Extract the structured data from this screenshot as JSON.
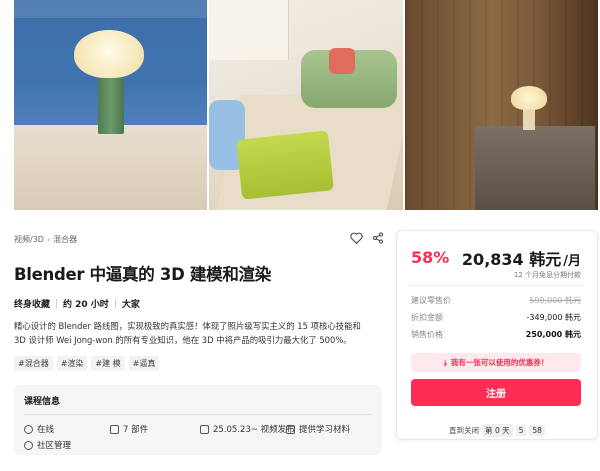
{
  "hero": {
    "panels": [
      "lamp-on-desk",
      "living-room-top-view",
      "lamp-on-console"
    ]
  },
  "breadcrumb": [
    "视频/3D",
    "混合器"
  ],
  "course": {
    "title": "Blender 中逼真的 3D 建模和渲染",
    "meta": [
      "终身收藏",
      "约 20 小时",
      "大家"
    ],
    "description": "精心设计的 Blender 路线图，实现极致的真实感！体现了照片级写实主义的 15 项核心技能和 3D 设计师 Wei Jong-won 的所有专业知识，他在 3D 中将产品的吸引力最大化了 500%。",
    "tags": [
      "#混合器",
      "#渲染",
      "#建 模",
      "#逼真"
    ]
  },
  "course_info": {
    "title": "课程信息",
    "items": {
      "online": "在线",
      "parts": "7 部件",
      "release": "25.05.23~ 视频发布",
      "materials": "提供学习材料",
      "community": "社区管理"
    }
  },
  "pricing": {
    "discount_pct": "58%",
    "price": "20,834 韩元",
    "per": "/月",
    "installment": "12 个月免息分期付款",
    "rows": [
      {
        "key": "建议零售价",
        "value": "599,000 韩元"
      },
      {
        "key": "折扣金额",
        "value": "-349,000 韩元"
      },
      {
        "key": "销售价格",
        "value": "250,000 韩元"
      }
    ],
    "coupon": "我有一张可以使用的优惠券！",
    "register": "注册",
    "countdown": {
      "label": "直到关闭",
      "d_prefix": "第",
      "days": "0",
      "d_suffix": "天",
      "h": "5",
      "m": "58"
    }
  },
  "colors": {
    "accent": "#ff2d55",
    "coupon_bg": "#ffe9ec"
  }
}
